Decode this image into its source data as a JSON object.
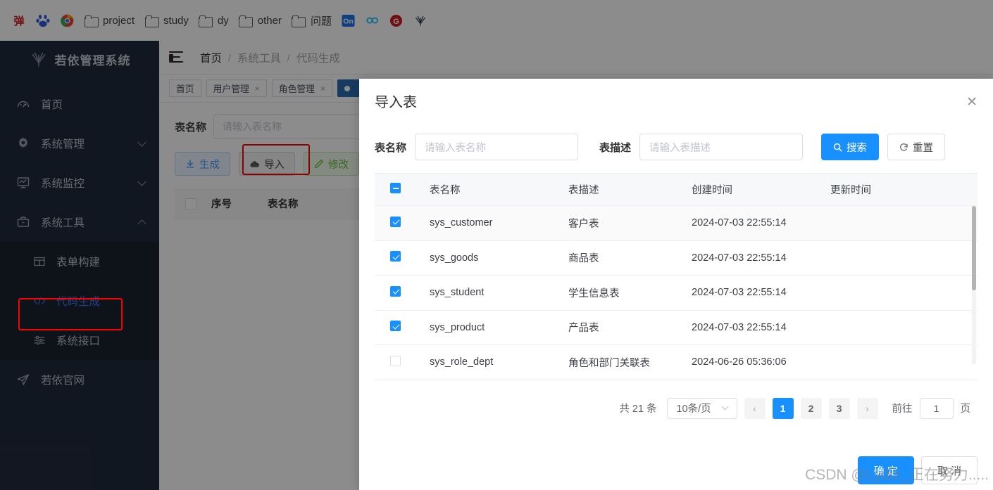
{
  "browser": {
    "bookmarks": [
      {
        "icon": "yi-red-logo-icon",
        "label": ""
      },
      {
        "icon": "baidu-paw-icon",
        "label": ""
      },
      {
        "icon": "chrome-circle-icon",
        "label": ""
      },
      {
        "icon": "folder-icon",
        "label": "project"
      },
      {
        "icon": "folder-icon",
        "label": "study"
      },
      {
        "icon": "folder-icon",
        "label": "dy"
      },
      {
        "icon": "folder-icon",
        "label": "other"
      },
      {
        "icon": "folder-icon",
        "label": "问题"
      },
      {
        "icon": "on-square-icon",
        "label": ""
      },
      {
        "icon": "infinity-icon",
        "label": ""
      },
      {
        "icon": "gitee-icon",
        "label": ""
      },
      {
        "icon": "ruoyi-leaf-icon",
        "label": ""
      }
    ]
  },
  "sidebar": {
    "logo_text": "若依管理系统",
    "items": [
      {
        "label": "首页",
        "icon": "dashboard-icon",
        "has_arrow": false
      },
      {
        "label": "系统管理",
        "icon": "gear-icon",
        "has_arrow": true,
        "expanded": false
      },
      {
        "label": "系统监控",
        "icon": "monitor-icon",
        "has_arrow": true,
        "expanded": false
      },
      {
        "label": "系统工具",
        "icon": "toolbox-icon",
        "has_arrow": true,
        "expanded": true
      }
    ],
    "submenu": [
      {
        "label": "表单构建",
        "icon": "table-icon",
        "active": false
      },
      {
        "label": "代码生成",
        "icon": "code-icon",
        "active": true
      },
      {
        "label": "系统接口",
        "icon": "sliders-icon",
        "active": false
      }
    ],
    "footer_item": {
      "label": "若依官网",
      "icon": "send-icon"
    }
  },
  "navbar": {
    "hamburger": "hamburger-icon",
    "breadcrumb": [
      "首页",
      "系统工具",
      "代码生成"
    ],
    "separator": "/"
  },
  "tagbar": {
    "tags": [
      {
        "label": "首页",
        "closable": false,
        "active": false
      },
      {
        "label": "用户管理",
        "closable": true,
        "active": false
      },
      {
        "label": "角色管理",
        "closable": true,
        "active": false
      },
      {
        "label": "",
        "closable": false,
        "active": true
      }
    ],
    "close_glyph": "×"
  },
  "page": {
    "search_label": "表名称",
    "search_placeholder": "请输入表名称",
    "buttons": [
      {
        "label": "生成",
        "icon": "download-icon",
        "type": "primary"
      },
      {
        "label": "导入",
        "icon": "cloud-upload-icon",
        "type": "info",
        "highlighted": true
      },
      {
        "label": "修改",
        "icon": "edit-icon",
        "type": "success"
      }
    ],
    "table_headers": [
      "序号",
      "表名称"
    ]
  },
  "dialog": {
    "title": "导入表",
    "close_glyph": "✕",
    "search": {
      "name_label": "表名称",
      "name_placeholder": "请输入表名称",
      "name_value": "",
      "desc_label": "表描述",
      "desc_placeholder": "请输入表描述",
      "desc_value": "",
      "search_button": "搜索",
      "search_icon": "search-icon",
      "reset_button": "重置",
      "reset_icon": "refresh-icon"
    },
    "table": {
      "headers": [
        "表名称",
        "表描述",
        "创建时间",
        "更新时间"
      ],
      "header_checkbox_state": "indeterminate",
      "rows": [
        {
          "checked": true,
          "name": "sys_customer",
          "desc": "客户表",
          "created": "2024-07-03 22:55:14",
          "updated": ""
        },
        {
          "checked": true,
          "name": "sys_goods",
          "desc": "商品表",
          "created": "2024-07-03 22:55:14",
          "updated": ""
        },
        {
          "checked": true,
          "name": "sys_student",
          "desc": "学生信息表",
          "created": "2024-07-03 22:55:14",
          "updated": ""
        },
        {
          "checked": true,
          "name": "sys_product",
          "desc": "产品表",
          "created": "2024-07-03 22:55:14",
          "updated": ""
        },
        {
          "checked": false,
          "name": "sys_role_dept",
          "desc": "角色和部门关联表",
          "created": "2024-06-26 05:36:06",
          "updated": ""
        }
      ]
    },
    "pagination": {
      "total_text": "共 21 条",
      "page_size": "10条/页",
      "prev_glyph": "‹",
      "next_glyph": "›",
      "pages": [
        "1",
        "2",
        "3"
      ],
      "current_page": "1",
      "jump_label": "前往",
      "jump_value": "1",
      "jump_unit": "页"
    },
    "footer": {
      "confirm": "确 定",
      "cancel": "取 消"
    }
  },
  "watermark": {
    "text": "CSDN @Lydia_正在努力....."
  },
  "colors": {
    "accent_blue": "#1890ff",
    "sidebar_bg": "#202a3c",
    "submenu_bg": "#1a212f",
    "active_blue": "#3a7afe",
    "highlight_red": "#ff0000"
  }
}
